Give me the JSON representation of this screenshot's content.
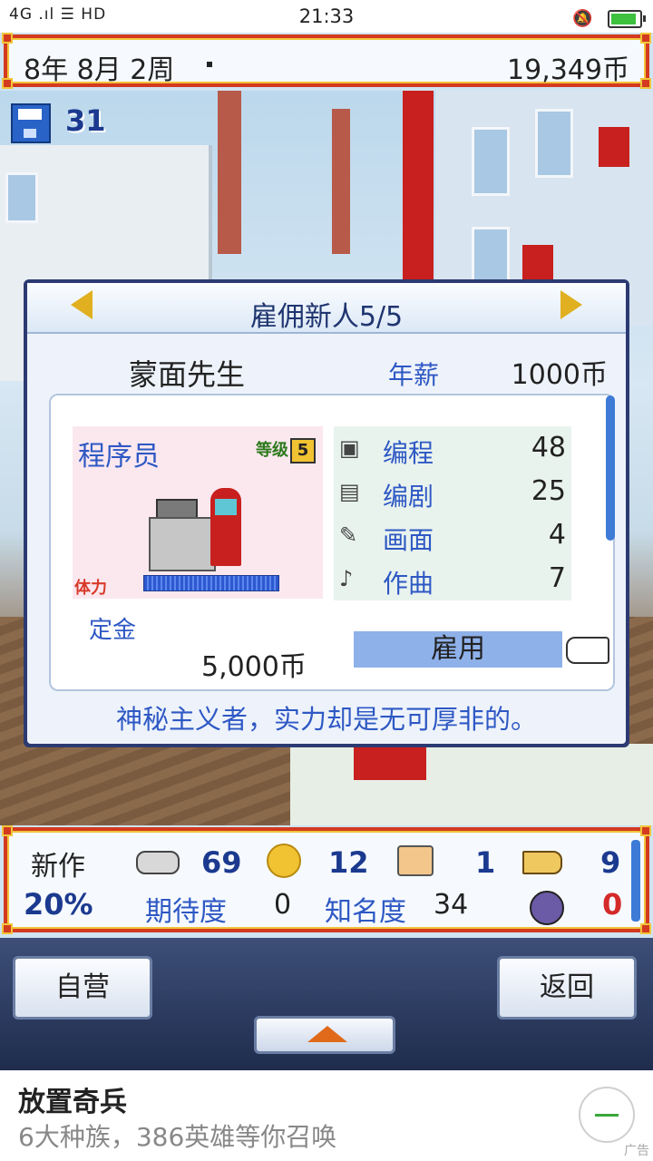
{
  "status_bar": {
    "signal": "4G .ıl ☰ HD",
    "time": "21:33"
  },
  "top_bar": {
    "date": "8年 8月 2周",
    "money": "19,349币"
  },
  "save_count": "31",
  "dialog": {
    "title": "雇佣新人5/5",
    "name": "蒙面先生",
    "salary_label": "年薪",
    "salary_value": "1000币",
    "job": "程序员",
    "level_label": "等级",
    "level_value": "5",
    "stamina_label": "体力",
    "stats": [
      {
        "label": "编程",
        "value": "48",
        "icon": "computer-icon"
      },
      {
        "label": "编剧",
        "value": "25",
        "icon": "book-icon"
      },
      {
        "label": "画面",
        "value": "4",
        "icon": "paint-icon"
      },
      {
        "label": "作曲",
        "value": "7",
        "icon": "trumpet-icon"
      }
    ],
    "deposit_label": "定金",
    "deposit_value": "5,000币",
    "hire_label": "雇用",
    "description": "神秘主义者，实力却是无可厚非的。"
  },
  "info_bar": {
    "new_label": "新作",
    "progress": "20%",
    "controller_value": "69",
    "coin_value": "12",
    "paint_value": "1",
    "music_value": "9",
    "expectation_label": "期待度",
    "expectation_value": "0",
    "fame_label": "知名度",
    "fame_value": "34",
    "fans_value": "0"
  },
  "nav": {
    "left_label": "自营",
    "right_label": "返回"
  },
  "ad": {
    "title": "放置奇兵",
    "subtitle": "6大种族，386英雄等你召唤",
    "tag": "广告"
  }
}
